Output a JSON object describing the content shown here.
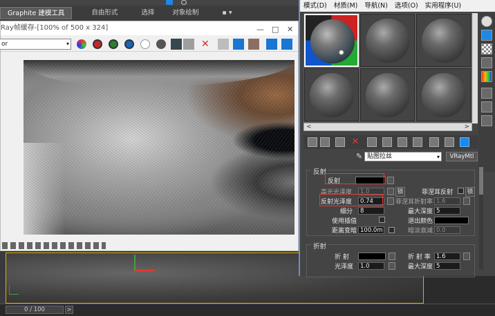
{
  "ribbon": {
    "tabs": [
      "Graphite 建模工具",
      "自由形式",
      "选择",
      "对象绘制",
      "▪ ▾"
    ]
  },
  "vfb": {
    "title": "Ray帧缓存-[100% of 500 x 324]",
    "channel_select": "or",
    "colors": {
      "red": "#c62828",
      "green": "#2e7d32",
      "blue": "#1565c0"
    }
  },
  "timeline": {
    "frame": "0 / 100",
    "next": ">"
  },
  "material_editor": {
    "menu": [
      "模式(D)",
      "材质(M)",
      "导航(N)",
      "选项(O)",
      "实用程序(U)"
    ],
    "material_name": "贴图拉丝",
    "material_type": "VRayMtl",
    "scroll_left": "<",
    "scroll_right": ">",
    "delete_icon": "✕",
    "reflection": {
      "section": "反射",
      "reflect_label": "反射",
      "hilight_gloss_label": "高光光泽度",
      "hilight_gloss_value": "1.0",
      "lock_label": "锁",
      "fresnel_label": "菲涅耳反射",
      "refl_gloss_label": "反射光泽度",
      "refl_gloss_value": "0.74",
      "fresnel_ior_label": "菲涅耳折射率",
      "fresnel_ior_value": "1.6",
      "subdivs_label": "细分",
      "subdivs_value": "8",
      "max_depth_label": "最大深度",
      "max_depth_value": "5",
      "interp_label": "使用插值",
      "exit_color_label": "退出颜色",
      "dim_dist_label": "距离变暗",
      "dim_dist_value": "100.0m",
      "dim_falloff_label": "暗淡衰减",
      "dim_falloff_value": "0.0",
      "lock2": "锁"
    },
    "refraction": {
      "section": "折射",
      "refract_label": "折 射",
      "ior_label": "折 射 率",
      "ior_value": "1.6",
      "gloss_label": "光泽度",
      "gloss_value": "1.0",
      "max_depth_label": "最大深度",
      "max_depth_value": "5"
    }
  }
}
